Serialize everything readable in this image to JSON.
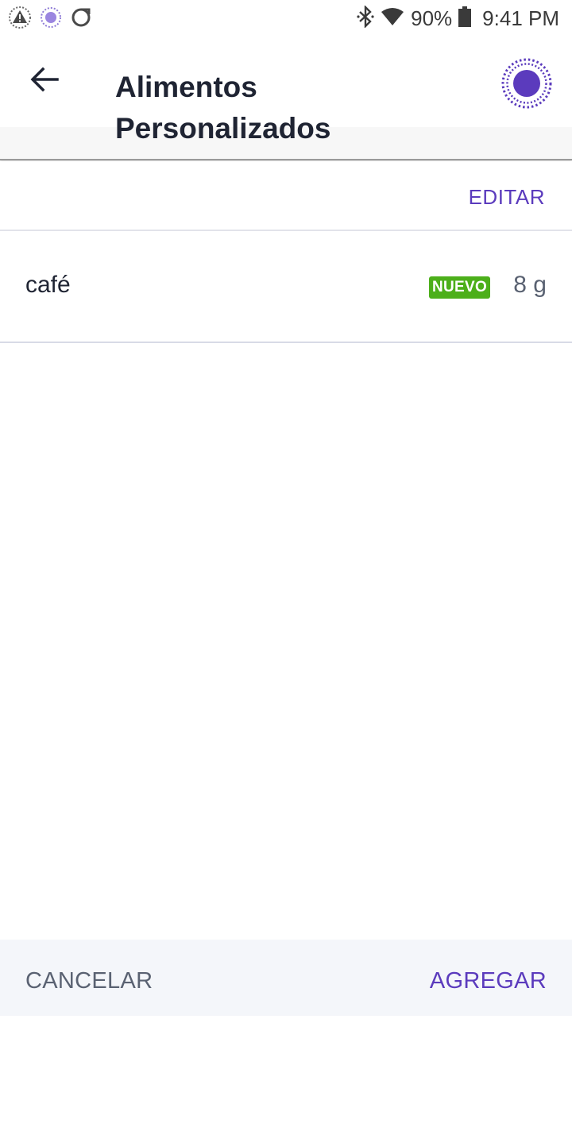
{
  "status_bar": {
    "battery": "90%",
    "time": "9:41 PM",
    "icons": [
      "alert-icon",
      "app-notification-icon",
      "circle-app-icon",
      "bluetooth-icon",
      "wifi-icon",
      "battery-icon"
    ]
  },
  "header": {
    "title": "Alimentos Personalizados",
    "back_icon": "arrow-back-icon",
    "avatar_icon": "profile-dot-icon"
  },
  "toolbar": {
    "edit_label": "EDITAR"
  },
  "foods": [
    {
      "name": "café",
      "badge": "NUEVO",
      "amount": "8 g"
    }
  ],
  "footer": {
    "cancel_label": "CANCELAR",
    "add_label": "AGREGAR"
  },
  "colors": {
    "accent": "#5b3bbd",
    "badge_green": "#4caf1a",
    "muted_text": "#5a6272",
    "bottom_bar": "#f4f6fa"
  }
}
